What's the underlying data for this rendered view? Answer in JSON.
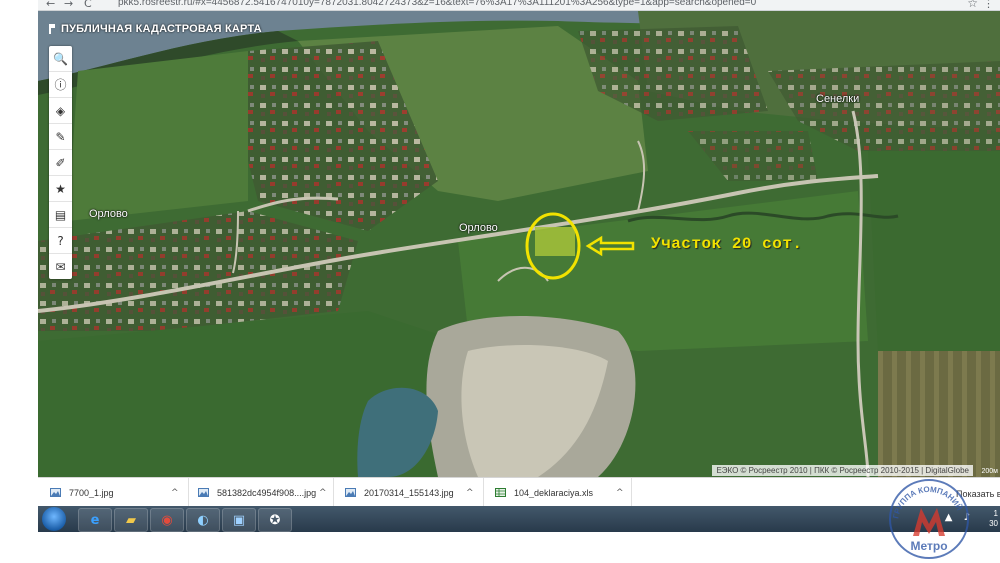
{
  "browser": {
    "url": "pkk5.rosreestr.ru/#x=4456872.5416747010y=7872031.8042724373&z=16&text=76%3A17%3A111201%3A256&type=1&app=search&opened=0",
    "back_glyph": "←",
    "forward_glyph": "→",
    "reload_glyph": "C"
  },
  "map": {
    "title": "ПУБЛИЧНАЯ КАДАСТРОВАЯ КАРТА",
    "tools": [
      {
        "name": "search-icon",
        "glyph": "🔍"
      },
      {
        "name": "info-icon",
        "glyph": "ⓘ"
      },
      {
        "name": "layers-icon",
        "glyph": "◈"
      },
      {
        "name": "draw-icon",
        "glyph": "✎"
      },
      {
        "name": "measure-icon",
        "glyph": "✐"
      },
      {
        "name": "star-icon",
        "glyph": "★"
      },
      {
        "name": "print-icon",
        "glyph": "▤"
      },
      {
        "name": "help-icon",
        "glyph": "?"
      },
      {
        "name": "mail-icon",
        "glyph": "✉"
      }
    ],
    "places": {
      "orlovo_left": "Орлово",
      "orlovo_road": "Орлово",
      "senelki": "Сенелки"
    },
    "annotation": "Участок 20 сот.",
    "attribution": "ЕЭКО © Росреестр 2010 | ПКК © Росреестр 2010-2015 | DigitalGlobe",
    "scale": "200м"
  },
  "downloads": {
    "items": [
      {
        "name": "7700_1.jpg"
      },
      {
        "name": "581382dc4954f908....jpg"
      },
      {
        "name": "20170314_155143.jpg"
      },
      {
        "name": "104_deklaraciya.xls"
      }
    ],
    "show_all": "Показать во",
    "chevron": "^"
  },
  "taskbar": {
    "apps": [
      {
        "name": "ie-icon",
        "glyph": "e",
        "color": "#3aa0ff"
      },
      {
        "name": "explorer-icon",
        "glyph": "▰",
        "color": "#f1c84a"
      },
      {
        "name": "chrome-icon",
        "glyph": "◉",
        "color": "#e24b3c"
      },
      {
        "name": "media-icon",
        "glyph": "◐",
        "color": "#8fd0ff"
      },
      {
        "name": "display-icon",
        "glyph": "▣",
        "color": "#9fd1ff"
      },
      {
        "name": "app-icon",
        "glyph": "✪",
        "color": "#ffffff"
      }
    ],
    "time": "1",
    "date": "30"
  },
  "watermark": {
    "top": "ГРУППА КОМПАНИЙ",
    "bottom": "Метро",
    "color": "#2f57a6"
  }
}
